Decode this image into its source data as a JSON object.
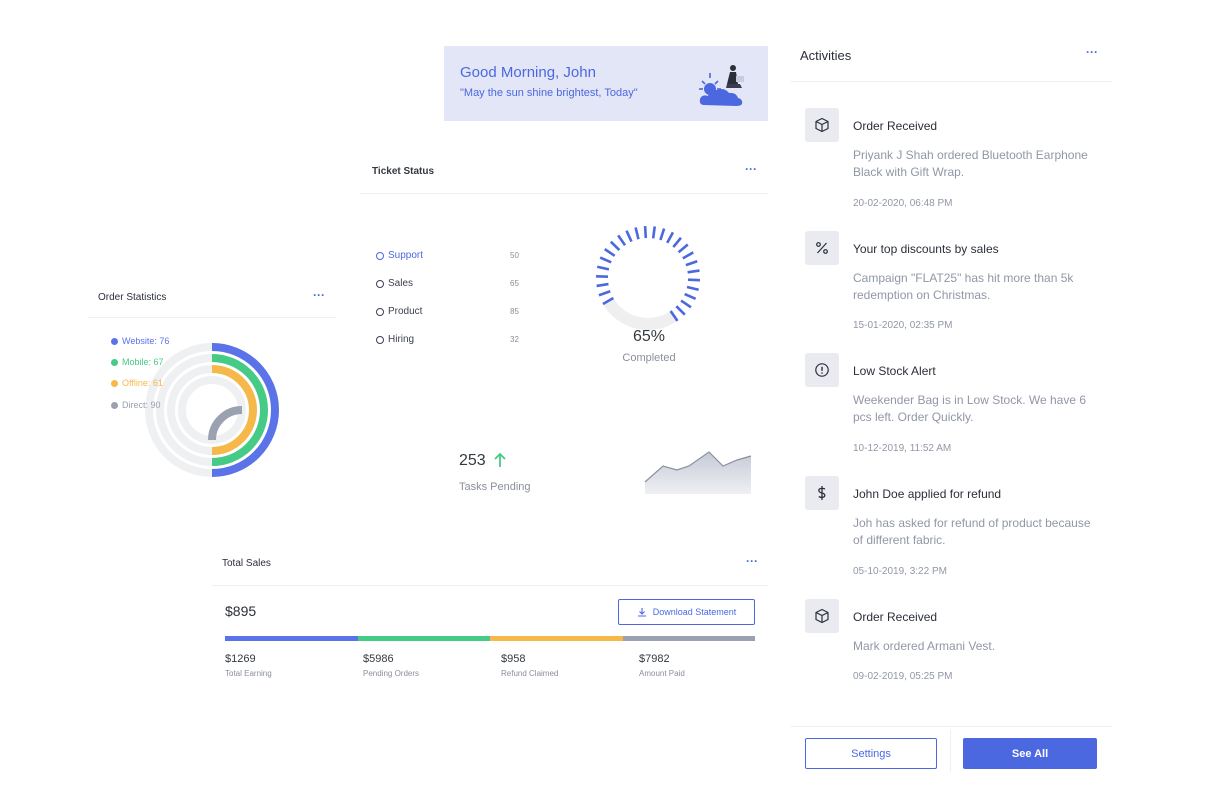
{
  "greeting": {
    "title": "Good Morning, John",
    "subtitle": "\"May the sun shine brightest, Today\""
  },
  "order_statistics": {
    "title": "Order Statistics",
    "menu_icon": "more-horizontal-icon",
    "legend": [
      {
        "label": "Website: 76",
        "color": "#5b73e8"
      },
      {
        "label": "Mobile: 67",
        "color": "#45cb85"
      },
      {
        "label": "Offline: 61",
        "color": "#f5b849"
      },
      {
        "label": "Direct: 90",
        "color": "#9aa1b0"
      }
    ]
  },
  "ticket_status": {
    "title": "Ticket Status",
    "menu_icon": "more-horizontal-icon",
    "items": [
      {
        "label": "Support",
        "value": "50",
        "active": true
      },
      {
        "label": "Sales",
        "value": "65",
        "active": false
      },
      {
        "label": "Product",
        "value": "85",
        "active": false
      },
      {
        "label": "Hiring",
        "value": "32",
        "active": false
      }
    ],
    "gauge_value": "65%",
    "gauge_label": "Completed",
    "gauge_fraction": 0.65,
    "tasks_value": "253",
    "tasks_label": "Tasks Pending",
    "trend_icon": "arrow-up-icon",
    "accent": "#4b68e0",
    "up_color": "#45cb85"
  },
  "total_sales": {
    "title": "Total Sales",
    "menu_icon": "more-horizontal-icon",
    "amount": "$895",
    "download_label": "Download Statement",
    "download_icon": "download-icon",
    "segments": [
      {
        "value": "$1269",
        "label": "Total Earning",
        "color": "#5b73e8"
      },
      {
        "value": "$5986",
        "label": "Pending Orders",
        "color": "#45cb85"
      },
      {
        "value": "$958",
        "label": "Refund Claimed",
        "color": "#f5b849"
      },
      {
        "value": "$7982",
        "label": "Amount Paid",
        "color": "#9aa1b0"
      }
    ]
  },
  "activities": {
    "title": "Activities",
    "menu_icon": "more-horizontal-icon",
    "items": [
      {
        "icon": "box-icon",
        "title": "Order Received",
        "desc": "Priyank J Shah ordered Bluetooth Earphone Black with Gift Wrap.",
        "time": "20-02-2020, 06:48 PM"
      },
      {
        "icon": "percent-icon",
        "title": "Your top discounts by sales",
        "desc": "Campaign \"FLAT25\" has hit more than 5k redemption on Christmas.",
        "time": "15-01-2020, 02:35 PM"
      },
      {
        "icon": "alert-circle-icon",
        "title": "Low Stock Alert",
        "desc": "Weekender Bag is in Low Stock. We have 6 pcs left. Order Quickly.",
        "time": "10-12-2019, 11:52 AM"
      },
      {
        "icon": "dollar-icon",
        "title": "John Doe applied for refund",
        "desc": "Joh has asked for refund of product because of different fabric.",
        "time": "05-10-2019, 3:22 PM"
      },
      {
        "icon": "box-icon",
        "title": "Order Received",
        "desc": "Mark ordered Armani Vest.",
        "time": "09-02-2019, 05:25 PM"
      }
    ],
    "settings_label": "Settings",
    "see_all_label": "See All"
  }
}
